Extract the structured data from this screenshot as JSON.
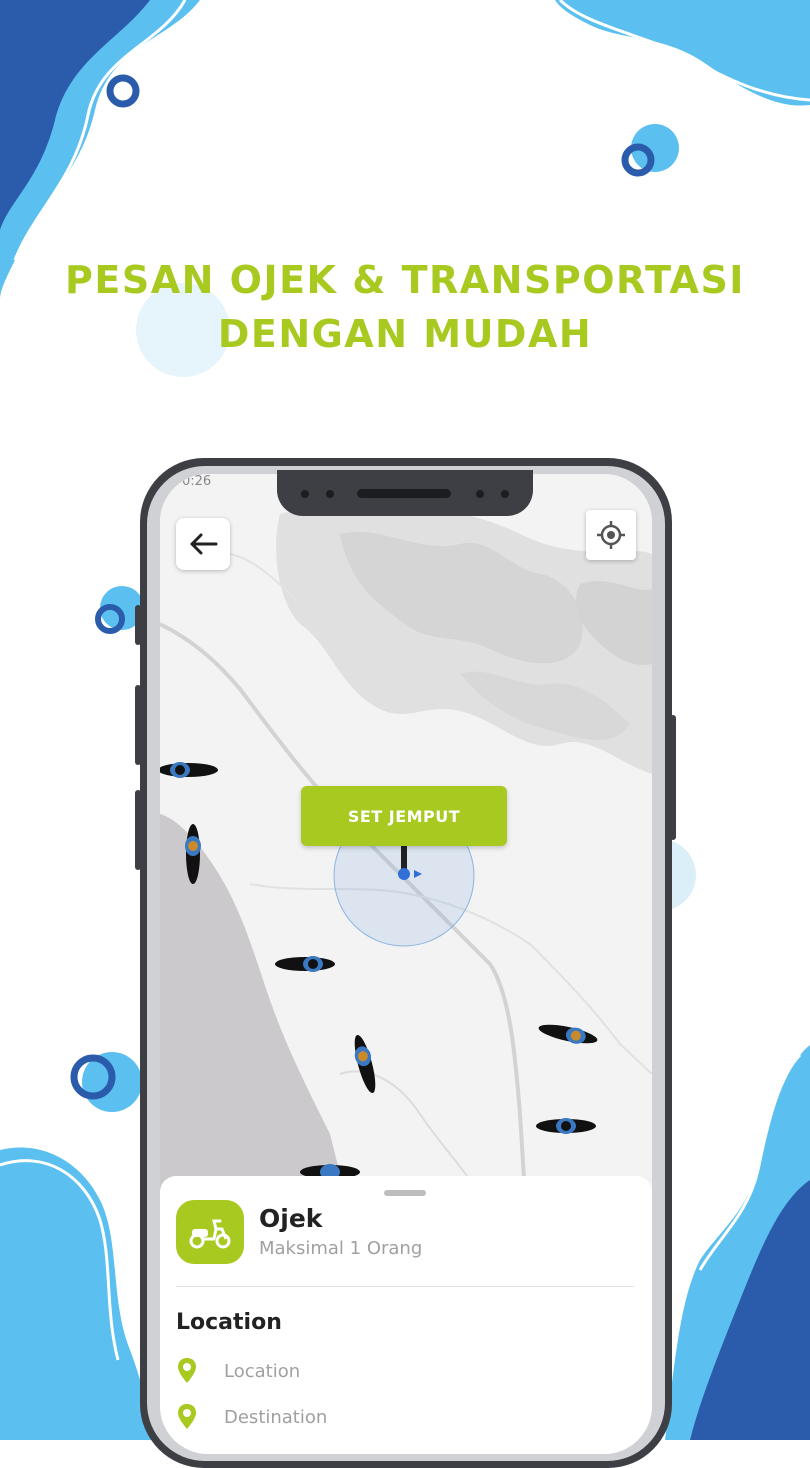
{
  "headline": {
    "line1": "PESAN OJEK & TRANSPORTASI",
    "line2": "DENGAN MUDAH",
    "color": "#a8c91f"
  },
  "colors": {
    "accent": "#a8c91f",
    "wave_light": "#5bc0ef",
    "wave_dark": "#2b5cab",
    "phone_frame": "#3d3f45"
  },
  "app": {
    "status_bar": {
      "time": "0:26"
    },
    "map": {
      "back_icon": "arrow-left-icon",
      "locate_icon": "crosshair-icon",
      "set_pickup_label": "SET JEMPUT"
    },
    "service": {
      "icon": "scooter-icon",
      "name": "Ojek",
      "capacity": "Maksimal 1 Orang"
    },
    "location": {
      "heading": "Location",
      "pickup_placeholder": "Location",
      "destination_placeholder": "Destination",
      "pin_icon": "map-pin-icon"
    }
  }
}
